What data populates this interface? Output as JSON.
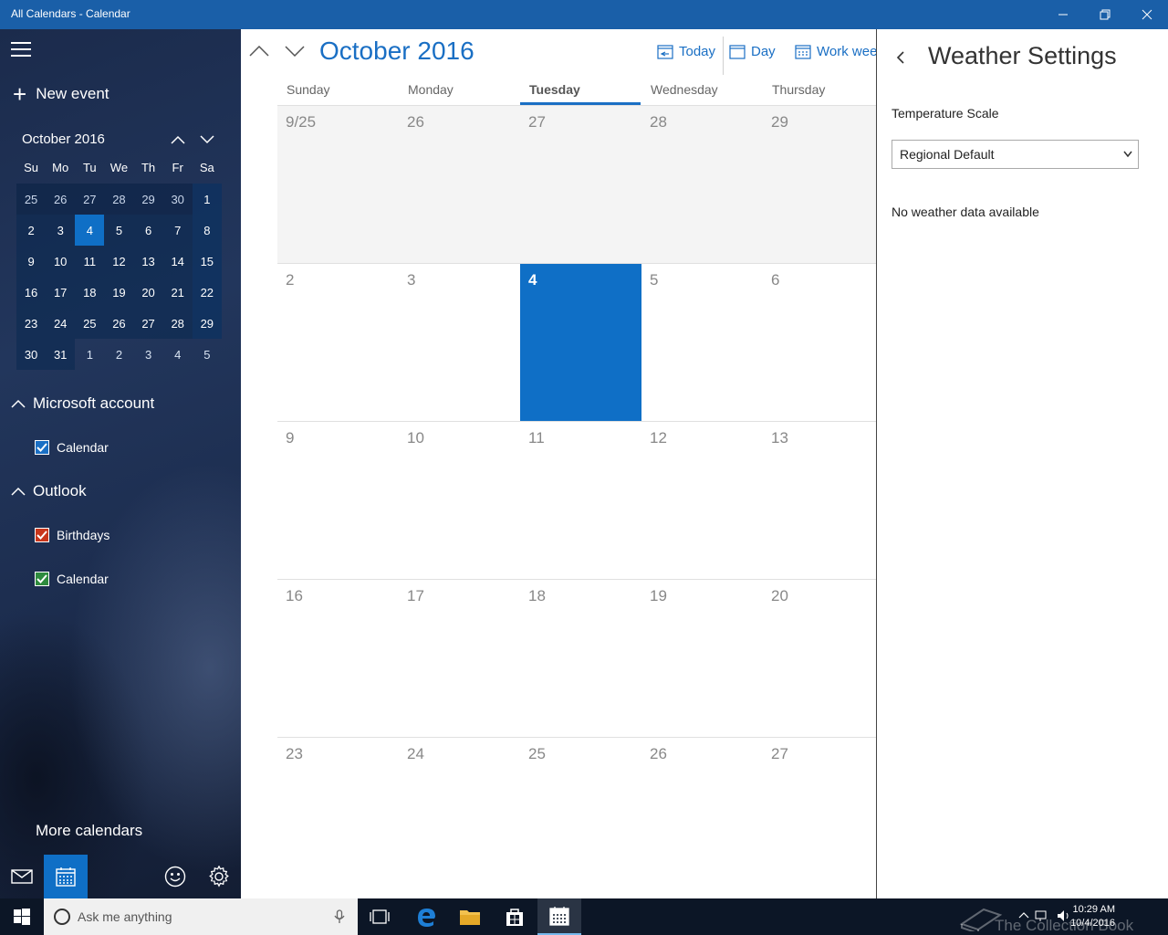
{
  "window": {
    "title": "All Calendars - Calendar"
  },
  "sidebar": {
    "new_event_label": "New event",
    "mini_calendar": {
      "month_label": "October 2016",
      "weekdays": [
        "Su",
        "Mo",
        "Tu",
        "We",
        "Th",
        "Fr",
        "Sa"
      ],
      "weeks": [
        [
          "25",
          "26",
          "27",
          "28",
          "29",
          "30",
          "1"
        ],
        [
          "2",
          "3",
          "4",
          "5",
          "6",
          "7",
          "8"
        ],
        [
          "9",
          "10",
          "11",
          "12",
          "13",
          "14",
          "15"
        ],
        [
          "16",
          "17",
          "18",
          "19",
          "20",
          "21",
          "22"
        ],
        [
          "23",
          "24",
          "25",
          "26",
          "27",
          "28",
          "29"
        ],
        [
          "30",
          "31",
          "1",
          "2",
          "3",
          "4",
          "5"
        ]
      ]
    },
    "accounts": [
      {
        "name": "Microsoft account",
        "calendars": [
          {
            "label": "Calendar",
            "color": "#1a6fc4"
          }
        ]
      },
      {
        "name": "Outlook",
        "calendars": [
          {
            "label": "Birthdays",
            "color": "#c8361c"
          },
          {
            "label": "Calendar",
            "color": "#2e8b3e"
          }
        ]
      }
    ],
    "more_calendars_label": "More calendars"
  },
  "main": {
    "month_title": "October 2016",
    "views": {
      "today": "Today",
      "day": "Day",
      "work_week": "Work week"
    },
    "weekday_headers": [
      "Sunday",
      "Monday",
      "Tuesday",
      "Wednesday",
      "Thursday"
    ],
    "active_weekday": "Tuesday",
    "weeks": [
      [
        "9/25",
        "26",
        "27",
        "28",
        "29"
      ],
      [
        "2",
        "3",
        "4",
        "5",
        "6"
      ],
      [
        "9",
        "10",
        "11",
        "12",
        "13"
      ],
      [
        "16",
        "17",
        "18",
        "19",
        "20"
      ],
      [
        "23",
        "24",
        "25",
        "26",
        "27"
      ]
    ],
    "today_label": "4"
  },
  "weather_settings": {
    "title": "Weather Settings",
    "temperature_scale_label": "Temperature Scale",
    "temperature_scale_value": "Regional Default",
    "no_data_message": "No weather data available"
  },
  "taskbar": {
    "search_placeholder": "Ask me anything",
    "time": "10:29 AM",
    "date": "10/4/2016"
  },
  "watermark": "The Collection Book",
  "colors": {
    "accent": "#1a6fc4",
    "title_bar": "#1a5fa8",
    "today_fill": "#0f6fc6"
  }
}
